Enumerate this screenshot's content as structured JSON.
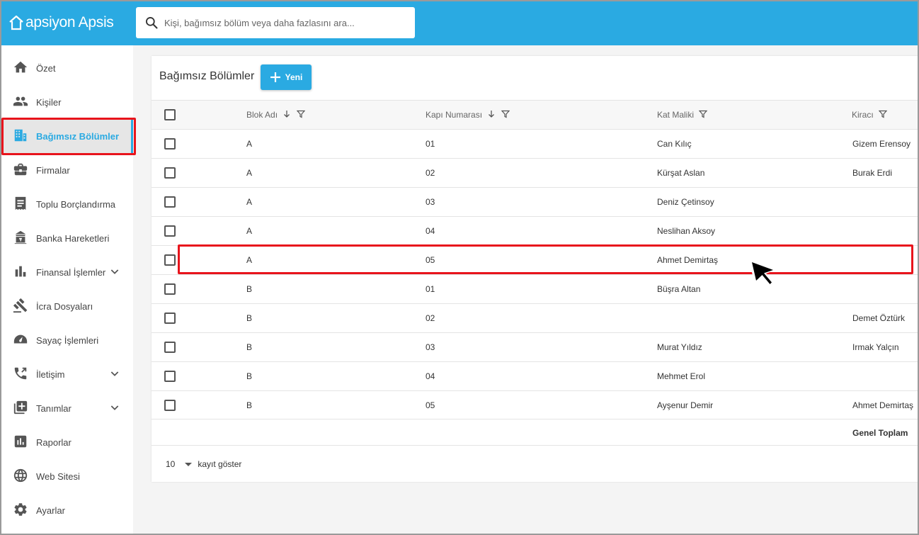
{
  "app": {
    "logo_text": "apsiyon Apsis",
    "brand_color": "#2aaae2",
    "highlight_color": "#e8141c"
  },
  "search": {
    "placeholder": "Kişi, bağımsız bölüm veya daha fazlasını ara..."
  },
  "sidebar": {
    "items": [
      {
        "label": "Özet",
        "icon": "home-icon"
      },
      {
        "label": "Kişiler",
        "icon": "people-icon"
      },
      {
        "label": "Bağımsız Bölümler",
        "icon": "building-icon",
        "active": true
      },
      {
        "label": "Firmalar",
        "icon": "briefcase-icon"
      },
      {
        "label": "Toplu Borçlandırma",
        "icon": "receipt-icon"
      },
      {
        "label": "Banka Hareketleri",
        "icon": "bank-icon"
      },
      {
        "label": "Finansal İşlemler",
        "icon": "bar-chart-icon",
        "expandable": true
      },
      {
        "label": "İcra Dosyaları",
        "icon": "gavel-icon"
      },
      {
        "label": "Sayaç İşlemleri",
        "icon": "meter-icon"
      },
      {
        "label": "İletişim",
        "icon": "phone-icon",
        "expandable": true
      },
      {
        "label": "Tanımlar",
        "icon": "add-box-icon",
        "expandable": true
      },
      {
        "label": "Raporlar",
        "icon": "report-icon"
      },
      {
        "label": "Web Sitesi",
        "icon": "globe-icon"
      },
      {
        "label": "Ayarlar",
        "icon": "gear-icon"
      }
    ]
  },
  "main": {
    "title": "Bağımsız Bölümler",
    "new_button": "Yeni",
    "columns": [
      "Blok Adı",
      "Kapı Numarası",
      "Kat Maliki",
      "Kiracı"
    ],
    "rows": [
      [
        "A",
        "01",
        "Can Kılıç",
        "Gizem Erensoy"
      ],
      [
        "A",
        "02",
        "Kürşat Aslan",
        "Burak Erdi"
      ],
      [
        "A",
        "03",
        "Deniz Çetinsoy",
        ""
      ],
      [
        "A",
        "04",
        "Neslihan Aksoy",
        ""
      ],
      [
        "A",
        "05",
        "Ahmet Demirtaş",
        ""
      ],
      [
        "B",
        "01",
        "Büşra Altan",
        ""
      ],
      [
        "B",
        "02",
        "",
        "Demet Öztürk"
      ],
      [
        "B",
        "03",
        "Murat Yıldız",
        "Irmak Yalçın"
      ],
      [
        "B",
        "04",
        "Mehmet Erol",
        ""
      ],
      [
        "B",
        "05",
        "Ayşenur Demir",
        "Ahmet Demirtaş"
      ]
    ],
    "total_label": "Genel Toplam",
    "page_size": "10",
    "page_size_label": "kayıt göster"
  }
}
